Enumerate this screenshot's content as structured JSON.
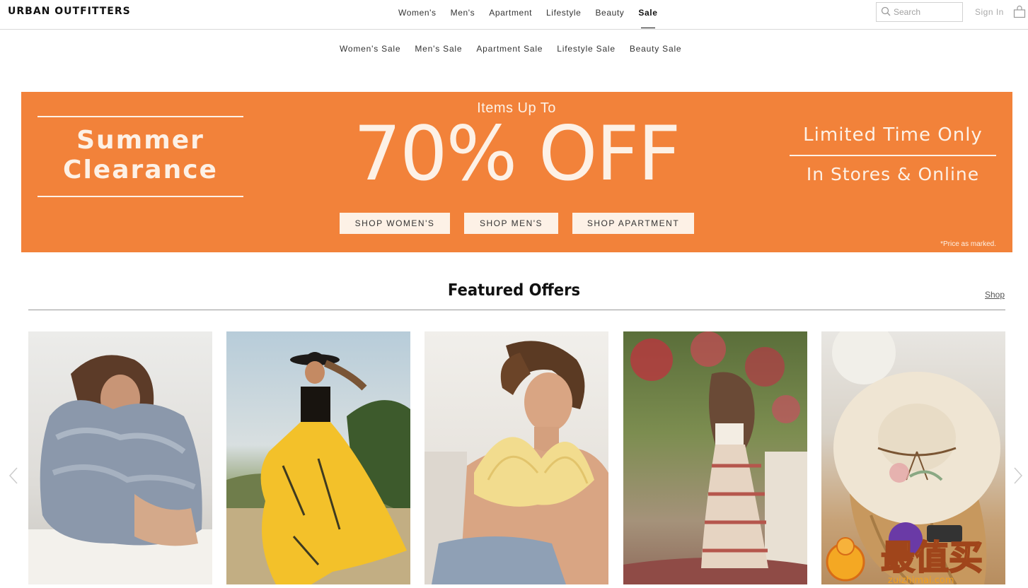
{
  "header": {
    "logo": "URBAN OUTFITTERS",
    "nav": [
      "Women's",
      "Men's",
      "Apartment",
      "Lifestyle",
      "Beauty",
      "Sale"
    ],
    "active_nav": "Sale",
    "search_placeholder": "Search",
    "sign_in": "Sign In"
  },
  "subnav": [
    "Women's Sale",
    "Men's Sale",
    "Apartment Sale",
    "Lifestyle Sale",
    "Beauty Sale"
  ],
  "banner": {
    "left_line1": "Summer",
    "left_line2": "Clearance",
    "top_text": "Items Up To",
    "big_text": "70% OFF",
    "right_line1": "Limited Time Only",
    "right_line2": "In Stores & Online",
    "buttons": [
      "SHOP WOMEN'S",
      "SHOP MEN'S",
      "SHOP APARTMENT"
    ],
    "fine_print": "*Price as marked.",
    "color": "#f2823a"
  },
  "featured": {
    "title": "Featured Offers",
    "link": "Shop"
  },
  "watermark": {
    "text": "最值买",
    "subtext": "zuizhimai.com"
  }
}
